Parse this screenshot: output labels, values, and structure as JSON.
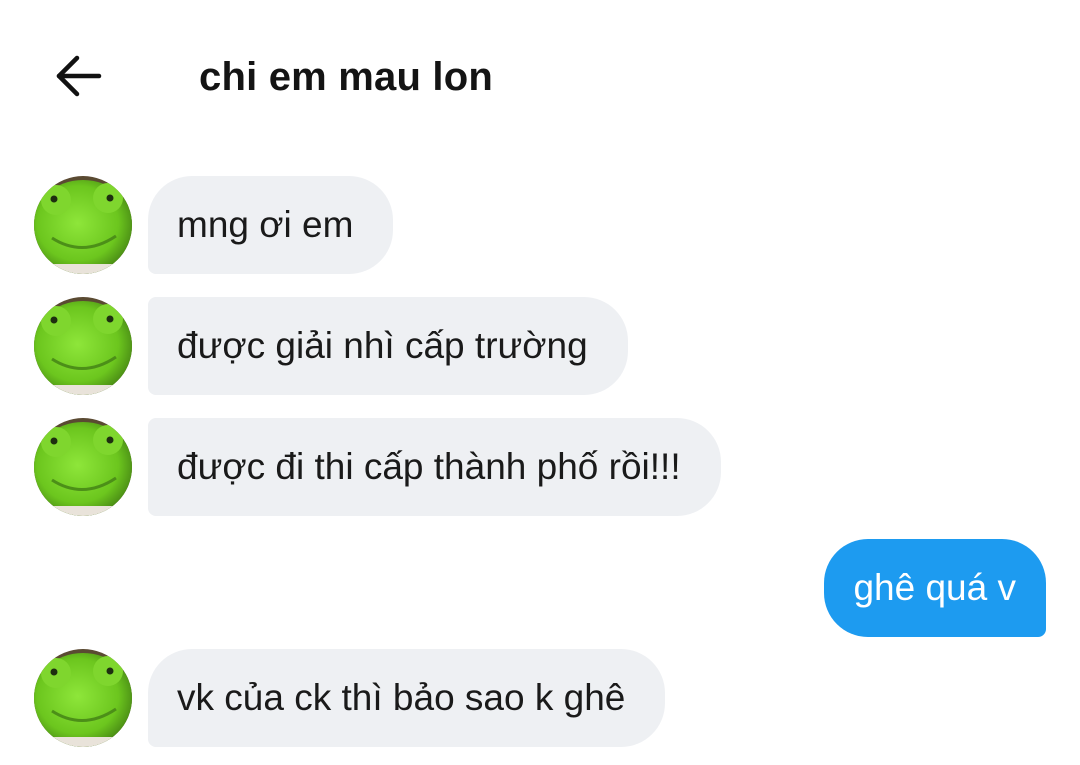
{
  "header": {
    "back_icon": "arrow-left-icon",
    "title": "chi em mau lon"
  },
  "colors": {
    "incoming_bubble": "#eef0f3",
    "outgoing_bubble": "#1d9bf0",
    "avatar_green": "#7ed321"
  },
  "messages": [
    {
      "direction": "incoming",
      "text": "mng ơi em",
      "avatar": "green-frog-plush-avatar"
    },
    {
      "direction": "incoming",
      "text": "được giải nhì cấp trường",
      "avatar": "green-frog-plush-avatar"
    },
    {
      "direction": "incoming",
      "text": "được đi thi cấp thành phố rồi!!!",
      "avatar": "green-frog-plush-avatar"
    },
    {
      "direction": "outgoing",
      "text": "ghê quá v"
    },
    {
      "direction": "incoming",
      "text": "vk của ck thì bảo sao k ghê",
      "avatar": "green-frog-plush-avatar"
    }
  ]
}
